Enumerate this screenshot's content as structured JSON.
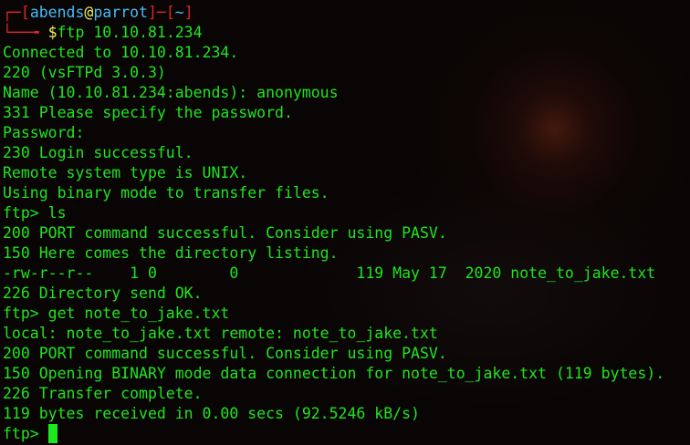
{
  "prompt": {
    "open": "┌─[",
    "user": "abends",
    "at": "@",
    "host": "parrot",
    "mid": "]─[",
    "dir": "~",
    "close": "]",
    "second": "└──╼ ",
    "dollar": "$",
    "command": "ftp 10.10.81.234"
  },
  "output": [
    "Connected to 10.10.81.234.",
    "220 (vsFTPd 3.0.3)",
    "Name (10.10.81.234:abends): anonymous",
    "331 Please specify the password.",
    "Password:",
    "230 Login successful.",
    "Remote system type is UNIX.",
    "Using binary mode to transfer files.",
    "ftp> ls",
    "200 PORT command successful. Consider using PASV.",
    "150 Here comes the directory listing.",
    "-rw-r--r--    1 0        0             119 May 17  2020 note_to_jake.txt",
    "226 Directory send OK.",
    "ftp> get note_to_jake.txt",
    "local: note_to_jake.txt remote: note_to_jake.txt",
    "200 PORT command successful. Consider using PASV.",
    "150 Opening BINARY mode data connection for note_to_jake.txt (119 bytes).",
    "226 Transfer complete.",
    "119 bytes received in 0.00 secs (92.5246 kB/s)"
  ],
  "final_prompt": "ftp> ",
  "colors": {
    "text": "#1ee61e",
    "prompt_frame": "#e0242a",
    "prompt_user": "#47b9f5",
    "prompt_at": "#f0f060",
    "background": "#0a0505"
  }
}
